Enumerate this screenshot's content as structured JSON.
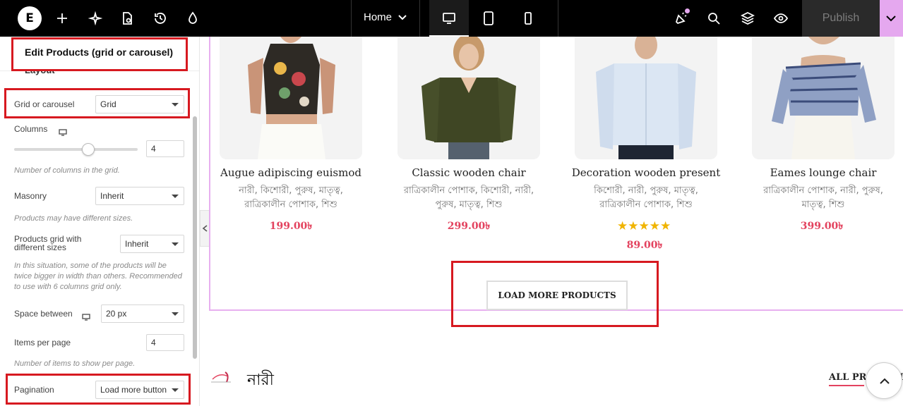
{
  "topbar": {
    "home_label": "Home",
    "publish_label": "Publish",
    "icons": [
      "elementor-logo-icon",
      "add-icon",
      "ai-sparkle-icon",
      "page-settings-icon",
      "history-icon",
      "theme-style-icon",
      "desktop-icon",
      "tablet-icon",
      "mobile-icon",
      "whats-new-icon",
      "search-icon",
      "structure-layers-icon",
      "preview-eye-icon",
      "chevron-down-icon"
    ],
    "accent_color": "#e5a8ef"
  },
  "panel": {
    "title": "Edit Products (grid or carousel)",
    "section": "Layout",
    "grid_or_carousel": {
      "label": "Grid or carousel",
      "value": "Grid"
    },
    "columns": {
      "label": "Columns",
      "value": "4",
      "hint": "Number of columns in the grid."
    },
    "masonry": {
      "label": "Masonry",
      "value": "Inherit",
      "hint": "Products may have different sizes."
    },
    "grid_different_sizes": {
      "label_line1": "Products grid with",
      "label_line2": "different sizes",
      "value": "Inherit",
      "hint_line1": "In this situation, some of the products will be",
      "hint_line2": "twice bigger in width than others. Recommended",
      "hint_line3": "to use with 6 columns grid only."
    },
    "space_between": {
      "label": "Space between",
      "value": "20 px"
    },
    "items_per_page": {
      "label": "Items per page",
      "value": "4",
      "hint": "Number of items to show per page."
    },
    "pagination": {
      "label": "Pagination",
      "value": "Load more button"
    }
  },
  "products": [
    {
      "title": "Augue adipiscing euismod",
      "cat_line1": "নারী, কিশোরী, পুরুষ, মাতৃত্ব,",
      "cat_line2": "রাত্রিকালীন পোশাক, শিশু",
      "price": "199.00৳"
    },
    {
      "title": "Classic wooden chair",
      "cat_line1": "রাত্রিকালীন পোশাক, কিশোরী, নারী,",
      "cat_line2": "পুরুষ, মাতৃত্ব, শিশু",
      "price": "299.00৳"
    },
    {
      "title": "Decoration wooden present",
      "cat_line1": "কিশোরী, নারী, পুরুষ, মাতৃত্ব,",
      "cat_line2": "রাত্রিকালীন পোশাক, শিশু",
      "price": "89.00৳",
      "rating": "★★★★★"
    },
    {
      "title": "Eames lounge chair",
      "cat_line1": "রাত্রিকালীন পোশাক, নারী, পুরুষ,",
      "cat_line2": "মাতৃত্ব, শিশু",
      "price": "399.00৳"
    }
  ],
  "load_more_label": "LOAD MORE PRODUCTS",
  "next_section": {
    "heading": "নারী",
    "all_products": "ALL PRODUCTS"
  },
  "price_color": "#e3435f",
  "highlight_color": "#d71920"
}
